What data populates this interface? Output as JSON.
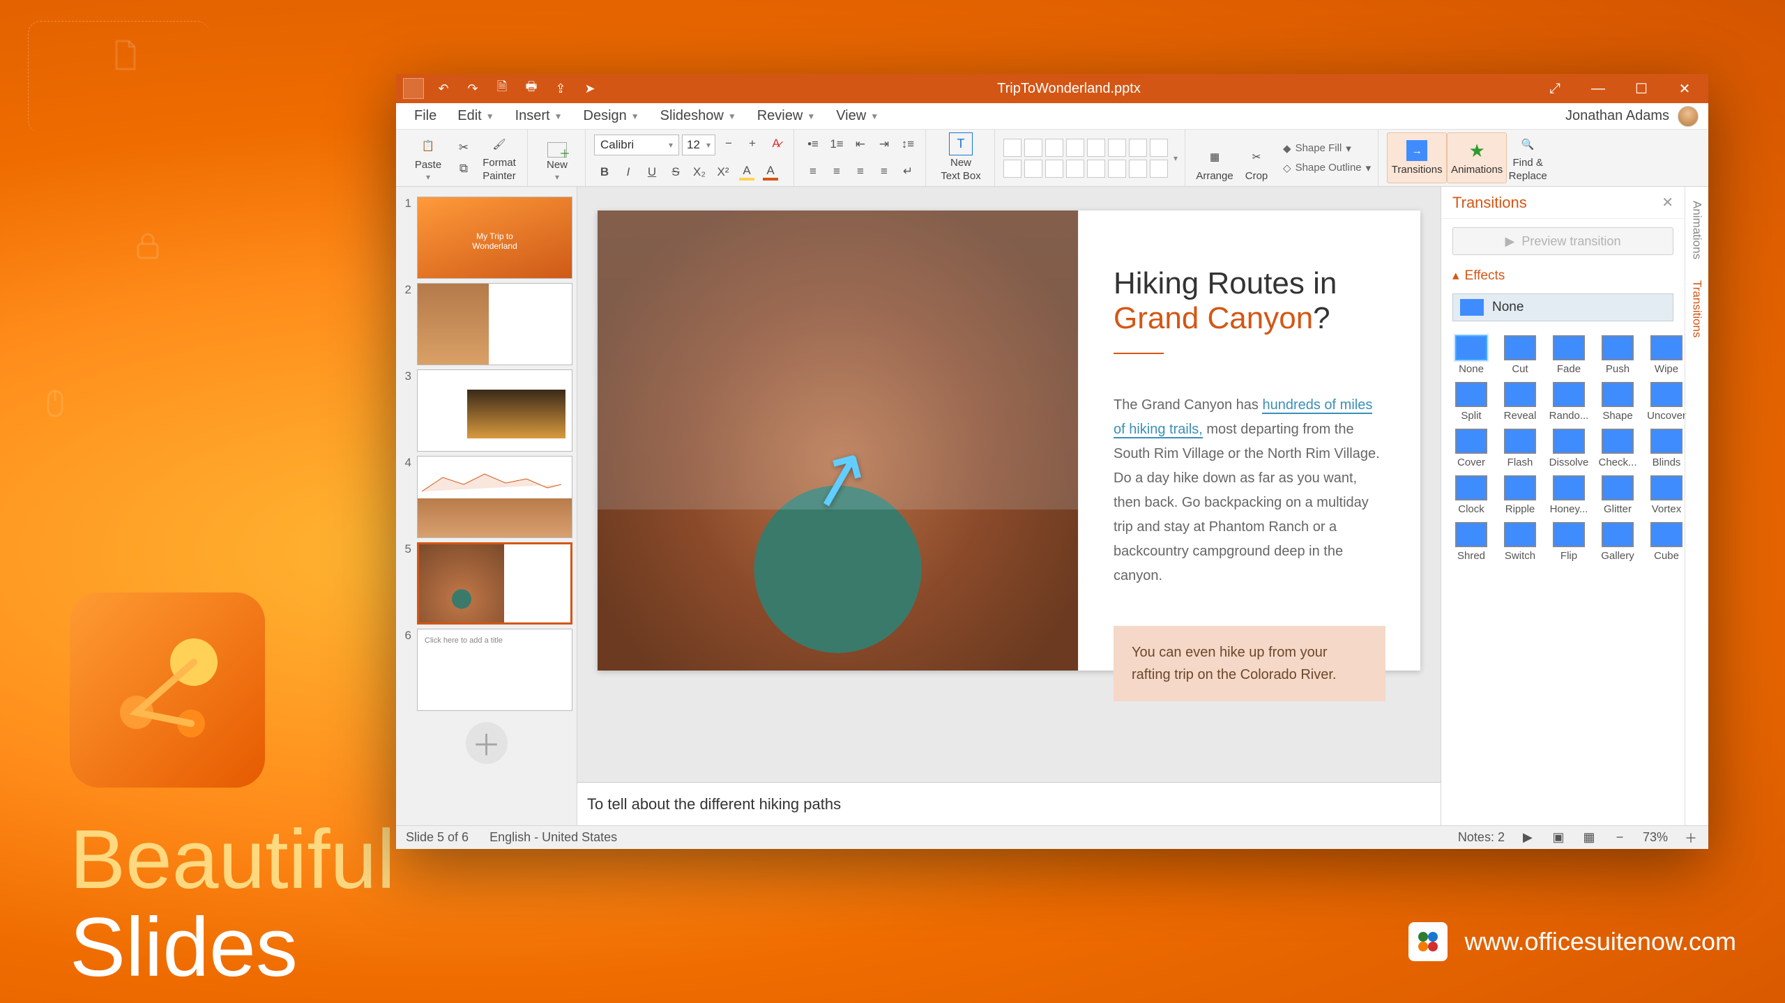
{
  "promo": {
    "line1": "Beautiful",
    "line2": "Slides",
    "url": "www.officesuitenow.com"
  },
  "titlebar": {
    "filename": "TripToWonderland.pptx"
  },
  "menus": [
    "File",
    "Edit",
    "Insert",
    "Design",
    "Slideshow",
    "Review",
    "View"
  ],
  "user": {
    "name": "Jonathan Adams"
  },
  "ribbon": {
    "paste": "Paste",
    "format_painter1": "Format",
    "format_painter2": "Painter",
    "new": "New",
    "font_family": "Calibri",
    "font_size": "12",
    "textbox1": "New",
    "textbox2": "Text Box",
    "arrange": "Arrange",
    "crop": "Crop",
    "shape_fill": "Shape Fill",
    "shape_outline": "Shape Outline",
    "transitions": "Transitions",
    "animations": "Animations",
    "find1": "Find &",
    "find2": "Replace"
  },
  "thumbnails": [
    {
      "n": "1",
      "caption": "My Trip to Wonderland"
    },
    {
      "n": "2",
      "caption": ""
    },
    {
      "n": "3",
      "caption": ""
    },
    {
      "n": "4",
      "caption": ""
    },
    {
      "n": "5",
      "caption": ""
    },
    {
      "n": "6",
      "caption": "Click here to add a title"
    }
  ],
  "slide": {
    "title_a": "Hiking Routes in ",
    "title_b": "Grand Canyon",
    "title_c": "?",
    "body_pre": "The Grand Canyon has ",
    "body_link": "hundreds of miles of hiking trails,",
    "body_post": " most departing from the South Rim Village or the North Rim Village. Do a day hike down as far as you want, then back. Go backpacking on a multiday trip and stay at Phantom Ranch or a backcountry campground deep in the canyon.",
    "callout": "You can even hike up from your rafting trip on the Colorado River."
  },
  "notes": {
    "value": "To tell about the different hiking paths"
  },
  "panel": {
    "title": "Transitions",
    "preview": "Preview transition",
    "effects": "Effects",
    "selected": "None",
    "items": [
      "None",
      "Cut",
      "Fade",
      "Push",
      "Wipe",
      "Split",
      "Reveal",
      "Rando...",
      "Shape",
      "Uncover",
      "Cover",
      "Flash",
      "Dissolve",
      "Check...",
      "Blinds",
      "Clock",
      "Ripple",
      "Honey...",
      "Glitter",
      "Vortex",
      "Shred",
      "Switch",
      "Flip",
      "Gallery",
      "Cube"
    ],
    "tab_anim": "Animations",
    "tab_trans": "Transitions"
  },
  "status": {
    "slide": "Slide 5 of 6",
    "lang": "English - United States",
    "notes": "Notes: 2",
    "zoom": "73%"
  }
}
